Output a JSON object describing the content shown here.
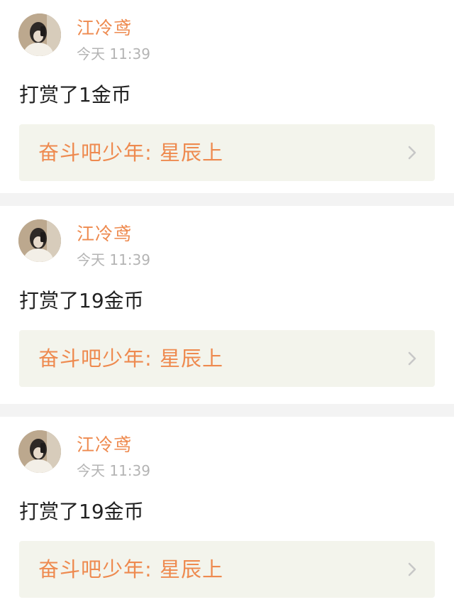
{
  "feed": {
    "items": [
      {
        "username": "江冷鸢",
        "timestamp": "今天 11:39",
        "message": "打赏了1金币",
        "book_title": "奋斗吧少年: 星辰上",
        "avatar_icon": "user-avatar-photo",
        "chevron_icon": "chevron-right-icon"
      },
      {
        "username": "江冷鸢",
        "timestamp": "今天 11:39",
        "message": "打赏了19金币",
        "book_title": "奋斗吧少年: 星辰上",
        "avatar_icon": "user-avatar-photo",
        "chevron_icon": "chevron-right-icon"
      },
      {
        "username": "江冷鸢",
        "timestamp": "今天 11:39",
        "message": "打赏了19金币",
        "book_title": "奋斗吧少年: 星辰上",
        "avatar_icon": "user-avatar-photo",
        "chevron_icon": "chevron-right-icon"
      }
    ]
  },
  "colors": {
    "accent": "#ee8a4f",
    "timestamp": "#b4b4b4",
    "text": "#222222",
    "link_background": "#f3f4ec",
    "divider_background": "#f3f3f3"
  }
}
